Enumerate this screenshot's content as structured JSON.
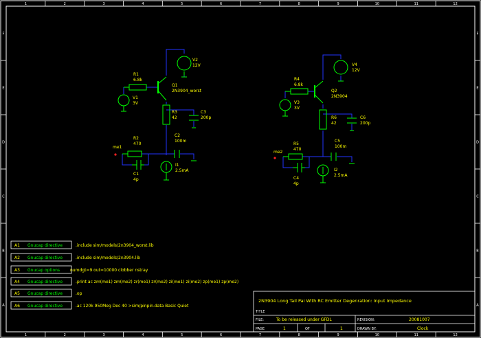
{
  "colors": {
    "wire": "#2233ff",
    "component": "#00ff00",
    "label": "#ffff00",
    "frame": "#ffffff",
    "net": "#ff2222",
    "background": "#000000"
  },
  "frame": {
    "top_numbers": [
      "1",
      "2",
      "3",
      "4",
      "5",
      "6",
      "7",
      "8",
      "9",
      "10",
      "11",
      "12"
    ],
    "bottom_numbers": [
      "1",
      "2",
      "3",
      "4",
      "5",
      "6",
      "7",
      "8",
      "9",
      "10",
      "11",
      "12"
    ],
    "left_letters": [
      "F",
      "E",
      "D",
      "C",
      "B",
      "A"
    ],
    "right_letters": [
      "F",
      "E",
      "D",
      "C",
      "B",
      "A"
    ]
  },
  "circuit1": {
    "r1": {
      "name": "R1",
      "value": "6.8k"
    },
    "v1": {
      "name": "V1",
      "value": "3V"
    },
    "q1": {
      "name": "Q1",
      "value": "2N3904_worst"
    },
    "v2": {
      "name": "V2",
      "value": "12V"
    },
    "r3": {
      "name": "R3",
      "value": "42"
    },
    "c3": {
      "name": "C3",
      "value": "200p"
    },
    "c2": {
      "name": "C2",
      "value": "100m"
    },
    "r2": {
      "name": "R2",
      "value": "470"
    },
    "net": "me1",
    "c1": {
      "name": "C1",
      "value": "4p"
    },
    "i1": {
      "name": "I1",
      "value": "2.5mA"
    }
  },
  "circuit2": {
    "r4": {
      "name": "R4",
      "value": "6.8k"
    },
    "v3": {
      "name": "V3",
      "value": "3V"
    },
    "q2": {
      "name": "Q2",
      "value": "2N3904"
    },
    "v4": {
      "name": "V4",
      "value": "12V"
    },
    "r6": {
      "name": "R6",
      "value": "42"
    },
    "c6": {
      "name": "C6",
      "value": "200p"
    },
    "c5": {
      "name": "C5",
      "value": "100m"
    },
    "r5": {
      "name": "R5",
      "value": "470"
    },
    "net": "me2",
    "c4": {
      "name": "C4",
      "value": "4p"
    },
    "i2": {
      "name": "I2",
      "value": "2.5mA"
    }
  },
  "directives": [
    {
      "id": "A1",
      "type": "Gnucap directive",
      "text": ".include sim/models/2n3904_worst.lib"
    },
    {
      "id": "A2",
      "type": "Gnucap directive",
      "text": ".include sim/models/2n3904.lib"
    },
    {
      "id": "A3",
      "type": "Gnucap options",
      "text": "numdgt=9 out=10000 clobber nstray"
    },
    {
      "id": "A4",
      "type": "Gnucap directive",
      "text": ".print ac zm(me1) zm(me2) zr(me1) zr(me2) zi(me1) zi(me2) zp(me1) zp(me2)"
    },
    {
      "id": "A5",
      "type": "Gnucap directive",
      "text": ".op"
    },
    {
      "id": "A6",
      "type": "Gnucap directive",
      "text": ".ac 120k 950Meg Dec 40 >sim/pinpin.data Basic Quiet"
    }
  ],
  "titleblock": {
    "title": "2N3904 Long Tail Pai With RC Emitter Degenration: Input Impedance",
    "title_label": "TITLE",
    "file_label": "FILE:",
    "file_value": "To be released under GFDL",
    "revision_label": "REVISION:",
    "revision_value": "20081007",
    "page_label": "PAGE",
    "page_value": "1",
    "of_label": "OF",
    "of_value": "1",
    "drawn_label": "DRAWN BY:",
    "drawn_value": "Clock"
  }
}
